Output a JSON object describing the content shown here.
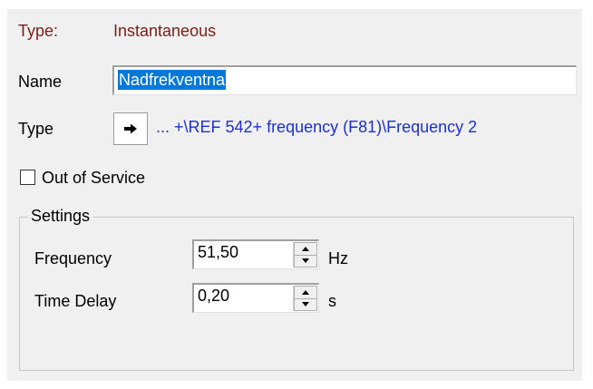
{
  "header": {
    "type_label": "Type:",
    "type_value": "Instantaneous"
  },
  "name": {
    "label": "Name",
    "value": "Nadfrekventna"
  },
  "type_row": {
    "label": "Type",
    "path": "... +\\REF 542+ frequency (F81)\\Frequency 2",
    "icon": "arrow-right-icon"
  },
  "out_of_service": {
    "label": "Out of Service",
    "checked": false
  },
  "settings": {
    "legend": "Settings",
    "frequency": {
      "label": "Frequency",
      "value": "51,50",
      "unit": "Hz"
    },
    "time_delay": {
      "label": "Time Delay",
      "value": "0,20",
      "unit": "s"
    }
  },
  "colors": {
    "accent": "#0078d7",
    "maroon": "#7a1e16",
    "link": "#1c2fd6",
    "panel": "#f0f0f0"
  }
}
